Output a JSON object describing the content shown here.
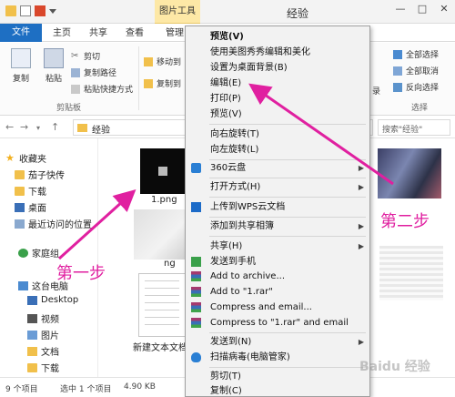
{
  "titlebar": {
    "context_tab": "图片工具",
    "window_title": "经验",
    "min": "—",
    "max": "□",
    "close": "✕"
  },
  "tabs": {
    "file": "文件",
    "home": "主页",
    "share": "共享",
    "view": "查看",
    "manage": "管理"
  },
  "ribbon": {
    "copy": "复制",
    "paste": "粘贴",
    "cut": "剪切",
    "copy_path": "复制路径",
    "paste_shortcut": "粘贴快捷方式",
    "clipboard_group": "剪贴板",
    "move_to": "移动到",
    "copy_to": "复制到",
    "open_partial": "录",
    "select_all": "全部选择",
    "select_none": "全部取消",
    "invert_select": "反向选择",
    "select_group": "选择"
  },
  "address": {
    "path": "经验",
    "search_placeholder": "搜索\"经验\""
  },
  "nav": {
    "favorites": "收藏夹",
    "items": [
      {
        "label": "茄子快传"
      },
      {
        "label": "下载"
      },
      {
        "label": "桌面"
      },
      {
        "label": "最近访问的位置"
      }
    ],
    "homegroup": "家庭组",
    "this_pc": "这台电脑",
    "pc_items": [
      {
        "label": "Desktop"
      },
      {
        "label": "视频"
      },
      {
        "label": "图片"
      },
      {
        "label": "文档"
      },
      {
        "label": "下载"
      }
    ]
  },
  "files": {
    "file1": "1.png",
    "file2": "ng",
    "file3": "新建文本文档.t"
  },
  "status": {
    "count": "9 个项目",
    "selected": "选中 1 个项目",
    "size": "4.90 KB"
  },
  "menu": {
    "items": [
      {
        "label": "预览(V)"
      },
      {
        "label": "使用美图秀秀编辑和美化"
      },
      {
        "label": "设置为桌面背景(B)"
      },
      {
        "label": "编辑(E)"
      },
      {
        "label": "打印(P)"
      },
      {
        "label": "预览(V)"
      },
      {
        "label": "向右旋转(T)"
      },
      {
        "label": "向左旋转(L)"
      },
      {
        "label": "360云盘"
      },
      {
        "label": "打开方式(H)"
      },
      {
        "label": "上传到WPS云文档"
      },
      {
        "label": "添加到共享相簿"
      },
      {
        "label": "共享(H)"
      },
      {
        "label": "发送到手机"
      },
      {
        "label": "Add to archive..."
      },
      {
        "label": "Add to \"1.rar\""
      },
      {
        "label": "Compress and email..."
      },
      {
        "label": "Compress to \"1.rar\" and email"
      },
      {
        "label": "发送到(N)"
      },
      {
        "label": "扫描病毒(电脑管家)"
      },
      {
        "label": "剪切(T)"
      },
      {
        "label": "复制(C)"
      }
    ]
  },
  "annotations": {
    "step1": "第一步",
    "step2": "第二步",
    "watermark": "Baidu 经验"
  },
  "colors": {
    "accent": "#1e6fc3",
    "annotation": "#e020a0",
    "context_tab_bg": "#fde8a6"
  }
}
